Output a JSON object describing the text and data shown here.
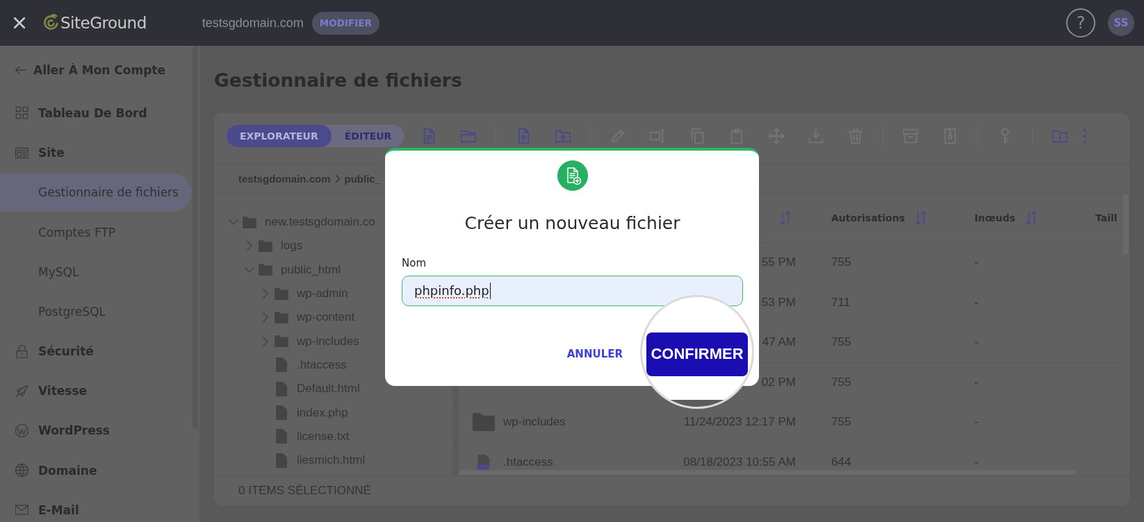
{
  "top_bar": {
    "logo_text": "SiteGround",
    "domain": "testsgdomain.com",
    "modify_button": "MODIFIER",
    "help_button": "?",
    "avatar_initials": "SS"
  },
  "sidebar": {
    "back_link": "Aller À Mon Compte",
    "sections": [
      {
        "label": "Tableau De Bord",
        "selected": false
      },
      {
        "label": "Site",
        "selected": false,
        "children": [
          {
            "label": "Gestionnaire de fichiers",
            "selected": true
          },
          {
            "label": "Comptes FTP",
            "selected": false
          },
          {
            "label": "MySQL",
            "selected": false
          },
          {
            "label": "PostgreSQL",
            "selected": false
          }
        ]
      },
      {
        "label": "Sécurité",
        "selected": false
      },
      {
        "label": "Vitesse",
        "selected": false
      },
      {
        "label": "WordPress",
        "selected": false
      },
      {
        "label": "Domaine",
        "selected": false
      },
      {
        "label": "E-Mail",
        "selected": false
      }
    ]
  },
  "page_title": "Gestionnaire de fichiers",
  "file_manager": {
    "view_tabs": [
      {
        "label": "EXPLORATEUR",
        "selected": true
      },
      {
        "label": "ÉDITEUR",
        "selected": false
      }
    ],
    "toolbar": {
      "groups": [
        {
          "actions": [
            {
              "disabled": false
            },
            {
              "disabled": false
            }
          ]
        },
        {
          "actions": [
            {
              "disabled": false
            },
            {
              "disabled": false
            }
          ]
        },
        {
          "actions": [
            {
              "disabled": true
            },
            {
              "disabled": true
            },
            {
              "disabled": true
            },
            {
              "disabled": true
            },
            {
              "disabled": true
            },
            {
              "disabled": true
            },
            {
              "disabled": true
            }
          ]
        },
        {
          "actions": [
            {
              "disabled": true
            },
            {
              "disabled": true
            }
          ]
        },
        {
          "actions": [
            {
              "disabled": true
            }
          ]
        },
        {
          "actions": [
            {
              "disabled": false
            },
            {
              "disabled": false
            }
          ]
        }
      ]
    },
    "breadcrumb": [
      "testsgdomain.com",
      "public_"
    ],
    "tree": [
      {
        "label": "new.testsgdomain.co",
        "kind": "folder",
        "expanded": true,
        "children": [
          {
            "label": "logs",
            "kind": "folder",
            "expanded": false
          },
          {
            "label": "public_html",
            "kind": "folder",
            "expanded": true,
            "children": [
              {
                "label": "wp-admin",
                "kind": "folder",
                "expanded": false
              },
              {
                "label": "wp-content",
                "kind": "folder",
                "expanded": false
              },
              {
                "label": "wp-includes",
                "kind": "folder",
                "expanded": false
              },
              {
                "label": ".htaccess",
                "kind": "file"
              },
              {
                "label": "Default.html",
                "kind": "file"
              },
              {
                "label": "index.php",
                "kind": "file"
              },
              {
                "label": "license.txt",
                "kind": "file"
              },
              {
                "label": "liesmich.html",
                "kind": "file"
              }
            ]
          }
        ]
      }
    ],
    "columns": [
      {
        "sortable": true
      },
      {
        "label": "Autorisations",
        "sortable": true
      },
      {
        "label": "Inœuds",
        "sortable": true
      },
      {
        "label": "Taill",
        "sortable": false
      }
    ],
    "rows": [
      {
        "modified": "55 PM",
        "permissions": "755",
        "inodes": "-"
      },
      {
        "modified": "53 PM",
        "permissions": "711",
        "inodes": "-"
      },
      {
        "modified": "47 AM",
        "permissions": "755",
        "inodes": "-"
      },
      {
        "modified": "02 PM",
        "permissions": "755",
        "inodes": "-"
      },
      {
        "kind": "folder",
        "name": "wp-includes",
        "modified": "11/24/2023 12:17 PM",
        "permissions": "755",
        "inodes": "-"
      },
      {
        "kind": "file",
        "name": ".htaccess",
        "modified": "08/18/2023 10:55 AM",
        "permissions": "644",
        "inodes": "-"
      }
    ],
    "footer": "0 ITEMS SÉLECTIONNÉ"
  },
  "modal": {
    "title": "Créer un nouveau fichier",
    "field": {
      "label": "Nom",
      "value": "phpinfo.php",
      "focused": true,
      "spellcheck_error": true
    },
    "buttons": [
      {
        "label": "ANNULER",
        "kind": "secondary",
        "magnified": false
      },
      {
        "label": "CONFIRMER",
        "kind": "primary",
        "magnified": true
      }
    ]
  }
}
